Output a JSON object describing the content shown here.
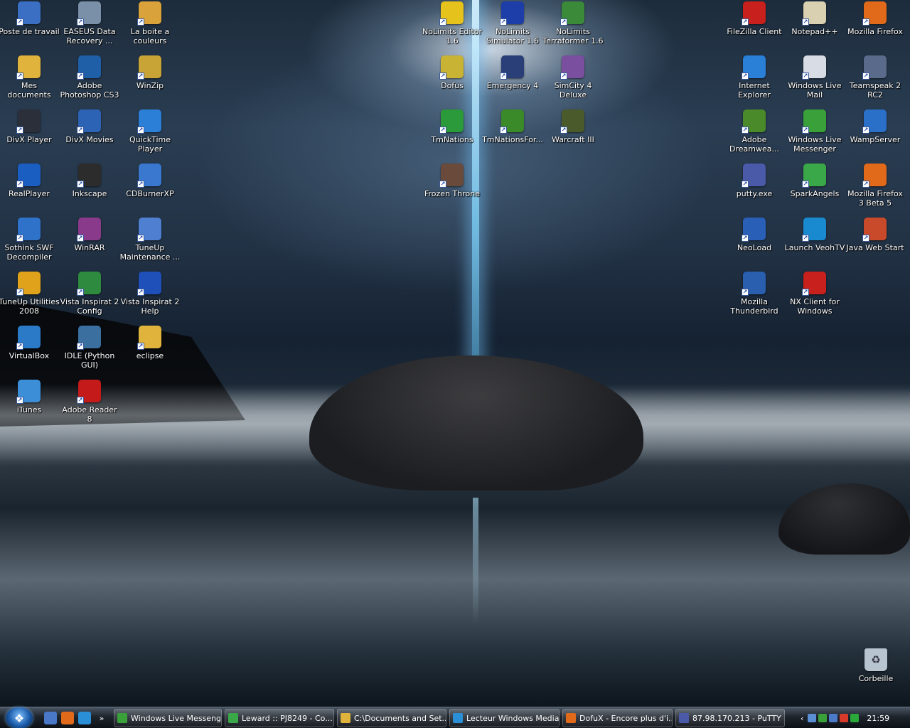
{
  "desktop": {
    "icons_left": [
      {
        "label": "Poste de travail",
        "icon": "computer-icon",
        "color": "#3a6fc4"
      },
      {
        "label": "EASEUS Data Recovery ...",
        "icon": "data-recovery-icon",
        "color": "#7a8fa8"
      },
      {
        "label": "La boite a couleurs",
        "icon": "color-box-icon",
        "color": "#d9a23a"
      },
      {
        "label": "Mes documents",
        "icon": "documents-folder-icon",
        "color": "#e0b43c"
      },
      {
        "label": "Adobe Photoshop CS3",
        "icon": "photoshop-icon",
        "color": "#1f5fa8"
      },
      {
        "label": "WinZip",
        "icon": "winzip-icon",
        "color": "#c8a437"
      },
      {
        "label": "DivX Player",
        "icon": "divx-player-icon",
        "color": "#2a2f3a"
      },
      {
        "label": "DivX Movies",
        "icon": "divx-movies-icon",
        "color": "#2d63b5"
      },
      {
        "label": "QuickTime Player",
        "icon": "quicktime-icon",
        "color": "#2b7fd6"
      },
      {
        "label": "RealPlayer",
        "icon": "realplayer-icon",
        "color": "#1b5ec2"
      },
      {
        "label": "Inkscape",
        "icon": "inkscape-icon",
        "color": "#2c2c2c"
      },
      {
        "label": "CDBurnerXP",
        "icon": "cdburner-icon",
        "color": "#3a78d0"
      },
      {
        "label": "Sothink SWF Decompiler",
        "icon": "sothink-icon",
        "color": "#2f72c9"
      },
      {
        "label": "WinRAR",
        "icon": "winrar-icon",
        "color": "#8a3a8a"
      },
      {
        "label": "TuneUp Maintenance ...",
        "icon": "tuneup-maintenance-icon",
        "color": "#4f7fd0"
      },
      {
        "label": "TuneUp Utilities 2008",
        "icon": "tuneup-utilities-icon",
        "color": "#e0a21a"
      },
      {
        "label": "Vista Inspirat 2 Config",
        "icon": "vista-inspirat-config-icon",
        "color": "#2e8a3e"
      },
      {
        "label": "Vista Inspirat 2 Help",
        "icon": "help-icon",
        "color": "#1f4fb8"
      },
      {
        "label": "VirtualBox",
        "icon": "virtualbox-icon",
        "color": "#2a7ac8"
      },
      {
        "label": "IDLE (Python GUI)",
        "icon": "python-icon",
        "color": "#3a6f9f"
      },
      {
        "label": "eclipse",
        "icon": "folder-icon",
        "color": "#e0b43c"
      },
      {
        "label": "iTunes",
        "icon": "itunes-icon",
        "color": "#3c8fd6"
      },
      {
        "label": "Adobe Reader 8",
        "icon": "adobe-reader-icon",
        "color": "#c41a1a"
      }
    ],
    "icons_center": [
      {
        "label": "NoLimits Editor 1.6",
        "icon": "nolimits-editor-icon",
        "color": "#e6c21c"
      },
      {
        "label": "NoLimits Simulator 1.6",
        "icon": "nolimits-simulator-icon",
        "color": "#1d3ea8"
      },
      {
        "label": "NoLimits Terraformer 1.6",
        "icon": "nolimits-terraformer-icon",
        "color": "#3a8a3a"
      },
      {
        "label": "Dofus",
        "icon": "dofus-icon",
        "color": "#c9b334"
      },
      {
        "label": "Emergency 4",
        "icon": "emergency4-icon",
        "color": "#2a3e78"
      },
      {
        "label": "SimCity 4 Deluxe",
        "icon": "simcity4-icon",
        "color": "#7a4fa0"
      },
      {
        "label": "TmNations",
        "icon": "tmnations-icon",
        "color": "#2a9a3a"
      },
      {
        "label": "TmNationsFor...",
        "icon": "tmnations-forever-icon",
        "color": "#3a8a2a"
      },
      {
        "label": "Warcraft III",
        "icon": "warcraft3-icon",
        "color": "#4a5a2a"
      },
      {
        "label": "Frozen Throne",
        "icon": "frozen-throne-icon",
        "color": "#6a4a3a"
      }
    ],
    "icons_right": [
      {
        "label": "FileZilla Client",
        "icon": "filezilla-icon",
        "color": "#c8201c"
      },
      {
        "label": "Notepad++",
        "icon": "notepadpp-icon",
        "color": "#d8d0b0"
      },
      {
        "label": "Mozilla Firefox",
        "icon": "firefox-icon",
        "color": "#e06a1a"
      },
      {
        "label": "Internet Explorer",
        "icon": "internet-explorer-icon",
        "color": "#2a7fd6"
      },
      {
        "label": "Windows Live Mail",
        "icon": "windows-live-mail-icon",
        "color": "#d8dce4"
      },
      {
        "label": "Teamspeak 2 RC2",
        "icon": "teamspeak-icon",
        "color": "#5a6a8a"
      },
      {
        "label": "Adobe Dreamwea...",
        "icon": "dreamweaver-icon",
        "color": "#4a8a2a"
      },
      {
        "label": "Windows Live Messenger",
        "icon": "messenger-icon",
        "color": "#3aa03a"
      },
      {
        "label": "WampServer",
        "icon": "wampserver-icon",
        "color": "#2a6fc8"
      },
      {
        "label": "putty.exe",
        "icon": "putty-icon",
        "color": "#4a5aa8"
      },
      {
        "label": "SparkAngels",
        "icon": "sparkangels-icon",
        "color": "#3aa848"
      },
      {
        "label": "Mozilla Firefox 3 Beta 5",
        "icon": "firefox-beta-icon",
        "color": "#e06a1a"
      },
      {
        "label": "NeoLoad",
        "icon": "neoload-icon",
        "color": "#2a5fb8"
      },
      {
        "label": "Launch VeohTV",
        "icon": "veohtv-icon",
        "color": "#1a8ad0"
      },
      {
        "label": "Java Web Start",
        "icon": "java-icon",
        "color": "#c84a2a"
      },
      {
        "label": "Mozilla Thunderbird",
        "icon": "thunderbird-icon",
        "color": "#2a5fb0"
      },
      {
        "label": "NX Client for Windows",
        "icon": "nx-client-icon",
        "color": "#c8201c"
      }
    ],
    "recycle_bin": {
      "label": "Corbeille",
      "icon": "recycle-bin-icon",
      "color": "#b8c4d0"
    }
  },
  "taskbar": {
    "start_label": "Start",
    "quick_launch": [
      {
        "icon": "show-desktop-icon",
        "color": "#4a78c8"
      },
      {
        "icon": "firefox-icon",
        "color": "#e06a1a"
      },
      {
        "icon": "media-player-icon",
        "color": "#2a8fd6"
      },
      {
        "icon": "chevron-icon",
        "color": "#000000"
      }
    ],
    "tasks": [
      {
        "label": "Windows Live Messenger",
        "icon": "messenger-icon",
        "color": "#3aa03a"
      },
      {
        "label": "Leward :: PJ8249 - Co...",
        "icon": "chat-icon",
        "color": "#3aa848"
      },
      {
        "label": "C:\\Documents and Set...",
        "icon": "folder-icon",
        "color": "#e0b43c"
      },
      {
        "label": "Lecteur Windows Media",
        "icon": "media-player-icon",
        "color": "#2a8fd6"
      },
      {
        "label": "DofuX - Encore plus d'i...",
        "icon": "firefox-icon",
        "color": "#e06a1a"
      },
      {
        "label": "87.98.170.213 - PuTTY",
        "icon": "putty-icon",
        "color": "#4a5aa8"
      }
    ],
    "tray": {
      "icons": [
        {
          "icon": "volume-icon",
          "color": "#5a8fd6"
        },
        {
          "icon": "messenger-tray-icon",
          "color": "#3aa03a"
        },
        {
          "icon": "network-icon",
          "color": "#4a7ac8"
        },
        {
          "icon": "security-shield-icon",
          "color": "#d83a2a"
        },
        {
          "icon": "network-connection-icon",
          "color": "#2aa83a"
        }
      ],
      "clock": "21:59"
    }
  }
}
